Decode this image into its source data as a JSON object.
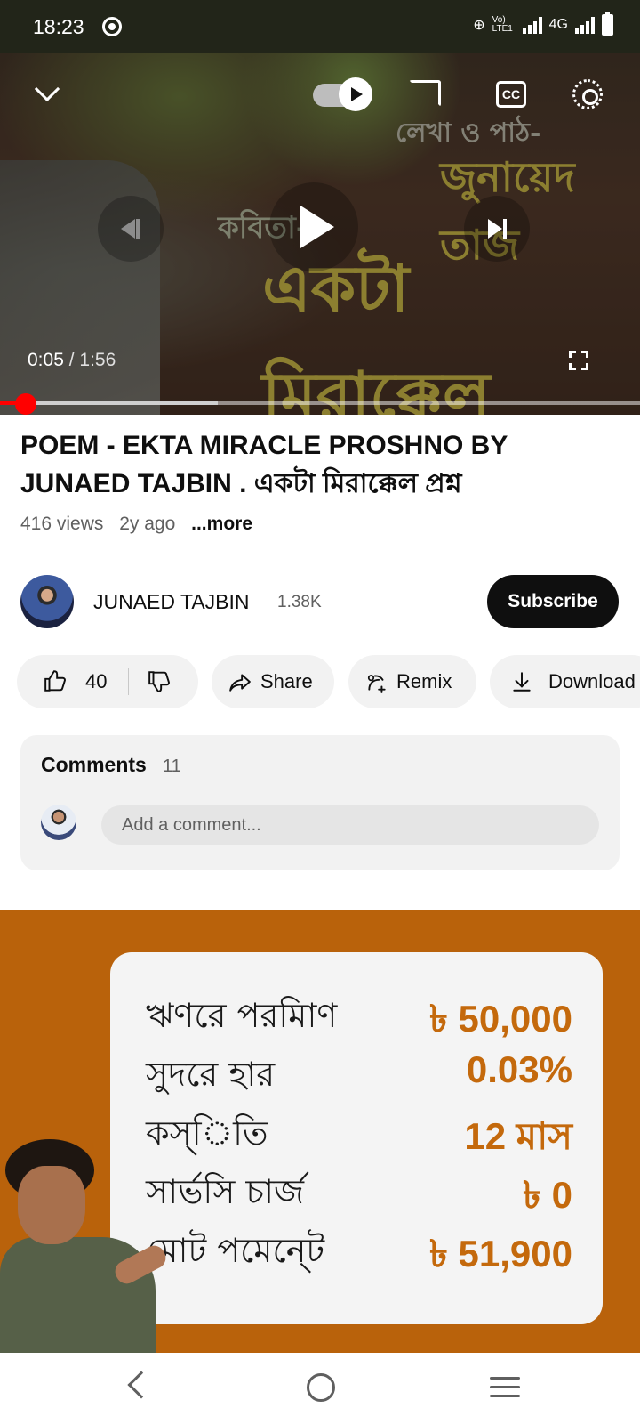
{
  "status_bar": {
    "time": "18:23",
    "volte": "Vo) LTE1",
    "network": "4G"
  },
  "player": {
    "current_time": "0:05",
    "duration": "/ 1:56",
    "progress_fraction": 0.04,
    "buffer_fraction": 0.34,
    "cc_label": "CC",
    "overlay_text": {
      "line1": "লেখা ও পাঠ-",
      "line2": "জুনায়েদ তাজ",
      "line3": "কবিতা-",
      "line4": "একটা মিরাক্কেল"
    }
  },
  "video": {
    "title": "POEM - EKTA MIRACLE PROSHNO BY JUNAED TAJBIN . একটা মিরাক্কেল প্রশ্ন",
    "views": "416 views",
    "age": "2y ago",
    "more": "...more"
  },
  "channel": {
    "name": "JUNAED TAJBIN",
    "subscribers": "1.38K",
    "subscribe_label": "Subscribe"
  },
  "actions": {
    "likes": "40",
    "share": "Share",
    "remix": "Remix",
    "download": "Download"
  },
  "comments": {
    "title": "Comments",
    "count": "11",
    "placeholder": "Add a comment..."
  },
  "ad": {
    "rows": [
      {
        "label": "ঋণরে পরমািণ",
        "value": "৳ 50,000"
      },
      {
        "label": "সুদরে হার",
        "value": "0.03%"
      },
      {
        "label": "কস্িতি",
        "value": "12 মাস"
      },
      {
        "label": "সার্ভসি চার্জ",
        "value": "৳ 0"
      },
      {
        "label": "মোট পমেনে্ট",
        "value": "৳ 51,900"
      }
    ],
    "background_color": "#b9620b",
    "value_color": "#c4690c"
  },
  "colors": {
    "accent_red": "#ff0000",
    "subscribe_bg": "#0f0f0f",
    "pill_bg": "#f2f2f2"
  }
}
